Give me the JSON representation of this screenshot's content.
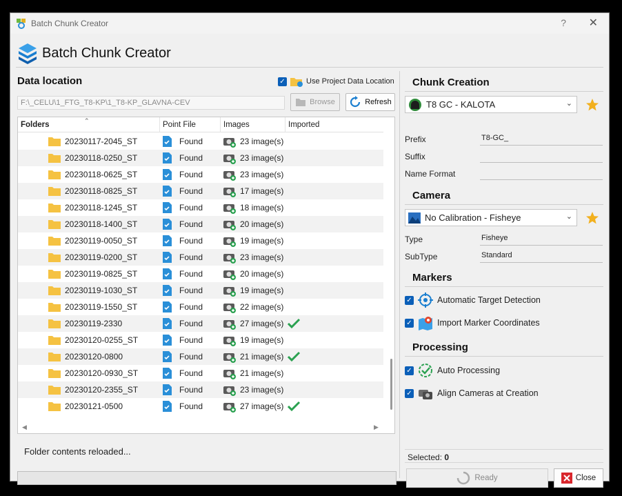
{
  "window": {
    "title": "Batch Chunk Creator",
    "help_glyph": "?",
    "close_glyph": "✕"
  },
  "header": {
    "title": "Batch Chunk Creator"
  },
  "data_location": {
    "title": "Data location",
    "use_project_label": "Use Project Data Location",
    "use_project_checked": true,
    "path": "F:\\_CELU\\1_FTG_T8-KP\\1_T8-KP_GLAVNA-CEV",
    "browse_label": "Browse",
    "refresh_label": "Refresh"
  },
  "tree": {
    "columns": [
      "Folders",
      "Point File",
      "Images",
      "Imported"
    ],
    "rows": [
      {
        "folder": "20230117-2045_ST",
        "point_file": "Found",
        "images": "23 image(s)",
        "imported": false
      },
      {
        "folder": "20230118-0250_ST",
        "point_file": "Found",
        "images": "23 image(s)",
        "imported": false
      },
      {
        "folder": "20230118-0625_ST",
        "point_file": "Found",
        "images": "23 image(s)",
        "imported": false
      },
      {
        "folder": "20230118-0825_ST",
        "point_file": "Found",
        "images": "17 image(s)",
        "imported": false
      },
      {
        "folder": "20230118-1245_ST",
        "point_file": "Found",
        "images": "18 image(s)",
        "imported": false
      },
      {
        "folder": "20230118-1400_ST",
        "point_file": "Found",
        "images": "20 image(s)",
        "imported": false
      },
      {
        "folder": "20230119-0050_ST",
        "point_file": "Found",
        "images": "19 image(s)",
        "imported": false
      },
      {
        "folder": "20230119-0200_ST",
        "point_file": "Found",
        "images": "23 image(s)",
        "imported": false
      },
      {
        "folder": "20230119-0825_ST",
        "point_file": "Found",
        "images": "20 image(s)",
        "imported": false
      },
      {
        "folder": "20230119-1030_ST",
        "point_file": "Found",
        "images": "19 image(s)",
        "imported": false
      },
      {
        "folder": "20230119-1550_ST",
        "point_file": "Found",
        "images": "22 image(s)",
        "imported": false
      },
      {
        "folder": "20230119-2330",
        "point_file": "Found",
        "images": "27 image(s)",
        "imported": true
      },
      {
        "folder": "20230120-0255_ST",
        "point_file": "Found",
        "images": "19 image(s)",
        "imported": false
      },
      {
        "folder": "20230120-0800",
        "point_file": "Found",
        "images": "21 image(s)",
        "imported": true
      },
      {
        "folder": "20230120-0930_ST",
        "point_file": "Found",
        "images": "21 image(s)",
        "imported": false
      },
      {
        "folder": "20230120-2355_ST",
        "point_file": "Found",
        "images": "23 image(s)",
        "imported": false
      },
      {
        "folder": "20230121-0500",
        "point_file": "Found",
        "images": "27 image(s)",
        "imported": true
      }
    ]
  },
  "status": {
    "text": "Folder contents reloaded..."
  },
  "chunk_creation": {
    "title": "Chunk Creation",
    "preset": "T8 GC - KALOTA",
    "prefix_label": "Prefix",
    "prefix_value": "T8-GC_",
    "suffix_label": "Suffix",
    "suffix_value": "",
    "name_format_label": "Name Format",
    "name_format_value": ""
  },
  "camera": {
    "title": "Camera",
    "preset": "No Calibration - Fisheye",
    "type_label": "Type",
    "type_value": "Fisheye",
    "subtype_label": "SubType",
    "subtype_value": "Standard"
  },
  "markers": {
    "title": "Markers",
    "auto_target_label": "Automatic Target Detection",
    "auto_target_checked": true,
    "import_marker_label": "Import Marker Coordinates",
    "import_marker_checked": true
  },
  "processing": {
    "title": "Processing",
    "auto_processing_label": "Auto Processing",
    "auto_processing_checked": true,
    "align_cameras_label": "Align Cameras at Creation",
    "align_cameras_checked": true
  },
  "footer": {
    "selected_label": "Selected:",
    "selected_count": "0",
    "ready_label": "Ready",
    "close_label": "Close"
  },
  "colors": {
    "accent": "#0b5fb8",
    "check_green": "#2aa150",
    "folder_yellow": "#f5c242",
    "star": "#f2b01e",
    "close_red": "#d9262c"
  }
}
